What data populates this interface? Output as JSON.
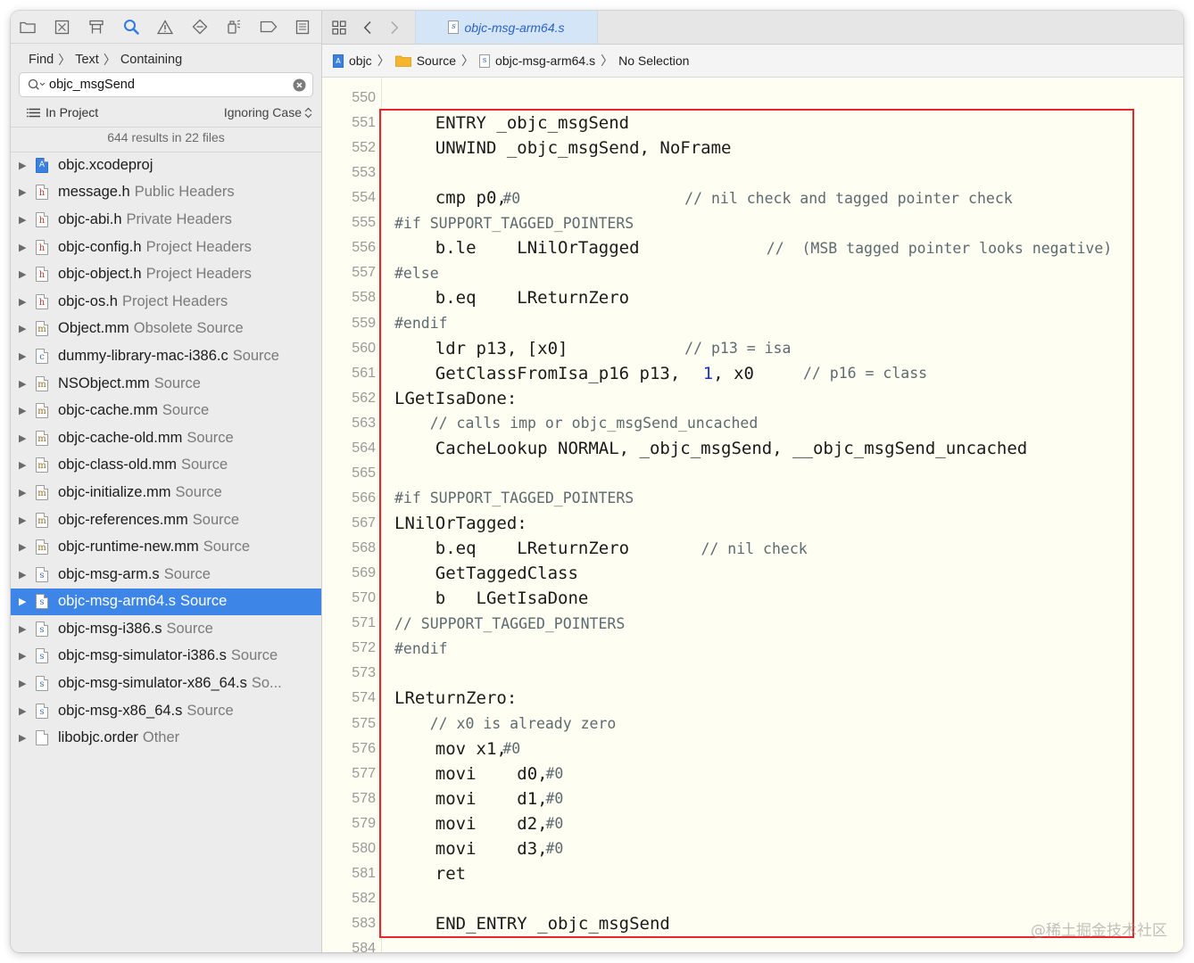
{
  "navigator": {
    "toolbar_icons": [
      "folder-icon",
      "source-control-icon",
      "hierarchy-icon",
      "search-icon",
      "warning-icon",
      "test-diamond-icon",
      "debug-spray-icon",
      "breakpoint-icon",
      "report-icon"
    ],
    "breadcrumb": [
      "Find",
      "Text",
      "Containing"
    ],
    "search": {
      "value": "objc_msgSend",
      "placeholder": ""
    },
    "scope": {
      "label": "In Project",
      "case_mode": "Ignoring Case"
    },
    "summary": "644 results in 22 files",
    "results": [
      {
        "icon": "proj",
        "name": "objc.xcodeproj",
        "category": ""
      },
      {
        "icon": "h",
        "name": "message.h",
        "category": "Public Headers"
      },
      {
        "icon": "h",
        "name": "objc-abi.h",
        "category": "Private Headers"
      },
      {
        "icon": "h",
        "name": "objc-config.h",
        "category": "Project Headers"
      },
      {
        "icon": "h",
        "name": "objc-object.h",
        "category": "Project Headers"
      },
      {
        "icon": "h",
        "name": "objc-os.h",
        "category": "Project Headers"
      },
      {
        "icon": "m",
        "name": "Object.mm",
        "category": "Obsolete Source"
      },
      {
        "icon": "c",
        "name": "dummy-library-mac-i386.c",
        "category": "Source"
      },
      {
        "icon": "m",
        "name": "NSObject.mm",
        "category": "Source"
      },
      {
        "icon": "m",
        "name": "objc-cache.mm",
        "category": "Source"
      },
      {
        "icon": "m",
        "name": "objc-cache-old.mm",
        "category": "Source"
      },
      {
        "icon": "m",
        "name": "objc-class-old.mm",
        "category": "Source"
      },
      {
        "icon": "m",
        "name": "objc-initialize.mm",
        "category": "Source"
      },
      {
        "icon": "m",
        "name": "objc-references.mm",
        "category": "Source"
      },
      {
        "icon": "m",
        "name": "objc-runtime-new.mm",
        "category": "Source"
      },
      {
        "icon": "s",
        "name": "objc-msg-arm.s",
        "category": "Source"
      },
      {
        "icon": "s",
        "name": "objc-msg-arm64.s",
        "category": "Source",
        "selected": true
      },
      {
        "icon": "s",
        "name": "objc-msg-i386.s",
        "category": "Source"
      },
      {
        "icon": "s",
        "name": "objc-msg-simulator-i386.s",
        "category": "Source"
      },
      {
        "icon": "s",
        "name": "objc-msg-simulator-x86_64.s",
        "category": "So..."
      },
      {
        "icon": "s",
        "name": "objc-msg-x86_64.s",
        "category": "Source"
      },
      {
        "icon": "doc",
        "name": "libobjc.order",
        "category": "Other"
      }
    ]
  },
  "editor": {
    "active_tab": "objc-msg-arm64.s",
    "jump_bar": [
      "objc",
      "Source",
      "objc-msg-arm64.s",
      "No Selection"
    ],
    "lines": [
      {
        "n": "550",
        "segs": []
      },
      {
        "n": "551",
        "segs": [
          {
            "t": "    ENTRY _objc_msgSend",
            "k": "k",
            "c": 0
          }
        ]
      },
      {
        "n": "552",
        "segs": [
          {
            "t": "    UNWIND _objc_msgSend, NoFrame",
            "k": "k",
            "c": 0
          }
        ]
      },
      {
        "n": "553",
        "segs": []
      },
      {
        "n": "554",
        "segs": [
          {
            "t": "    cmp p0, ",
            "k": "k",
            "c": 0
          },
          {
            "t": "#0",
            "k": "c",
            "c": 10.6
          },
          {
            "t": "// nil check and tagged pointer check",
            "k": "c",
            "c": 28.4
          }
        ]
      },
      {
        "n": "555",
        "segs": [
          {
            "t": "#if SUPPORT_TAGGED_POINTERS",
            "k": "c",
            "c": 0
          }
        ]
      },
      {
        "n": "556",
        "segs": [
          {
            "t": "    b.le    LNilOrTagged",
            "k": "k",
            "c": 0
          },
          {
            "t": "//  (MSB tagged pointer looks negative)",
            "k": "c",
            "c": 36.4
          }
        ]
      },
      {
        "n": "557",
        "segs": [
          {
            "t": "#else",
            "k": "c",
            "c": 0
          }
        ]
      },
      {
        "n": "558",
        "segs": [
          {
            "t": "    b.eq    LReturnZero",
            "k": "k",
            "c": 0
          }
        ]
      },
      {
        "n": "559",
        "segs": [
          {
            "t": "#endif",
            "k": "c",
            "c": 0
          }
        ]
      },
      {
        "n": "560",
        "segs": [
          {
            "t": "    ldr p13, [x0]",
            "k": "k",
            "c": 0
          },
          {
            "t": "// p13 = isa",
            "k": "c",
            "c": 28.4
          }
        ]
      },
      {
        "n": "561",
        "segs": [
          {
            "t": "    GetClassFromIsa_p16 p13, ",
            "k": "k",
            "c": 0
          },
          {
            "t": "1",
            "k": "n",
            "c": 30.2
          },
          {
            "t": ", x0",
            "k": "k",
            "c": 31.2
          },
          {
            "t": "// p16 = class",
            "k": "c",
            "c": 40.0
          }
        ]
      },
      {
        "n": "562",
        "segs": [
          {
            "t": "LGetIsaDone:",
            "k": "k",
            "c": 0
          }
        ]
      },
      {
        "n": "563",
        "segs": [
          {
            "t": "    // calls imp or objc_msgSend_uncached",
            "k": "c",
            "c": 0
          }
        ]
      },
      {
        "n": "564",
        "segs": [
          {
            "t": "    CacheLookup NORMAL, _objc_msgSend, __objc_msgSend_uncached",
            "k": "k",
            "c": 0
          }
        ]
      },
      {
        "n": "565",
        "segs": []
      },
      {
        "n": "566",
        "segs": [
          {
            "t": "#if SUPPORT_TAGGED_POINTERS",
            "k": "c",
            "c": 0
          }
        ]
      },
      {
        "n": "567",
        "segs": [
          {
            "t": "LNilOrTagged:",
            "k": "k",
            "c": 0
          }
        ]
      },
      {
        "n": "568",
        "segs": [
          {
            "t": "    b.eq    LReturnZero",
            "k": "k",
            "c": 0
          },
          {
            "t": "// nil check",
            "k": "c",
            "c": 30.0
          }
        ]
      },
      {
        "n": "569",
        "segs": [
          {
            "t": "    GetTaggedClass",
            "k": "k",
            "c": 0
          }
        ]
      },
      {
        "n": "570",
        "segs": [
          {
            "t": "    b   LGetIsaDone",
            "k": "k",
            "c": 0
          }
        ]
      },
      {
        "n": "571",
        "segs": [
          {
            "t": "// SUPPORT_TAGGED_POINTERS",
            "k": "c",
            "c": 0
          }
        ]
      },
      {
        "n": "572",
        "segs": [
          {
            "t": "#endif",
            "k": "c",
            "c": 0
          }
        ]
      },
      {
        "n": "573",
        "segs": []
      },
      {
        "n": "574",
        "segs": [
          {
            "t": "LReturnZero:",
            "k": "k",
            "c": 0
          }
        ]
      },
      {
        "n": "575",
        "segs": [
          {
            "t": "    // x0 is already zero",
            "k": "c",
            "c": 0
          }
        ]
      },
      {
        "n": "576",
        "segs": [
          {
            "t": "    mov x1, ",
            "k": "k",
            "c": 0
          },
          {
            "t": "#0",
            "k": "c",
            "c": 10.6
          }
        ]
      },
      {
        "n": "577",
        "segs": [
          {
            "t": "    movi    d0, ",
            "k": "k",
            "c": 0
          },
          {
            "t": "#0",
            "k": "c",
            "c": 14.8
          }
        ]
      },
      {
        "n": "578",
        "segs": [
          {
            "t": "    movi    d1, ",
            "k": "k",
            "c": 0
          },
          {
            "t": "#0",
            "k": "c",
            "c": 14.8
          }
        ]
      },
      {
        "n": "579",
        "segs": [
          {
            "t": "    movi    d2, ",
            "k": "k",
            "c": 0
          },
          {
            "t": "#0",
            "k": "c",
            "c": 14.8
          }
        ]
      },
      {
        "n": "580",
        "segs": [
          {
            "t": "    movi    d3, ",
            "k": "k",
            "c": 0
          },
          {
            "t": "#0",
            "k": "c",
            "c": 14.8
          }
        ]
      },
      {
        "n": "581",
        "segs": [
          {
            "t": "    ret",
            "k": "k",
            "c": 0
          }
        ]
      },
      {
        "n": "582",
        "segs": []
      },
      {
        "n": "583",
        "segs": [
          {
            "t": "    END_ENTRY _objc_msgSend",
            "k": "k",
            "c": 0
          }
        ]
      },
      {
        "n": "584",
        "segs": []
      }
    ]
  },
  "watermark": "@稀土掘金技术社区",
  "colors": {
    "selection": "#3d86e8",
    "highlight_box": "#e8262d",
    "editor_bg": "#fffef3",
    "number": "#1b2fd0"
  }
}
